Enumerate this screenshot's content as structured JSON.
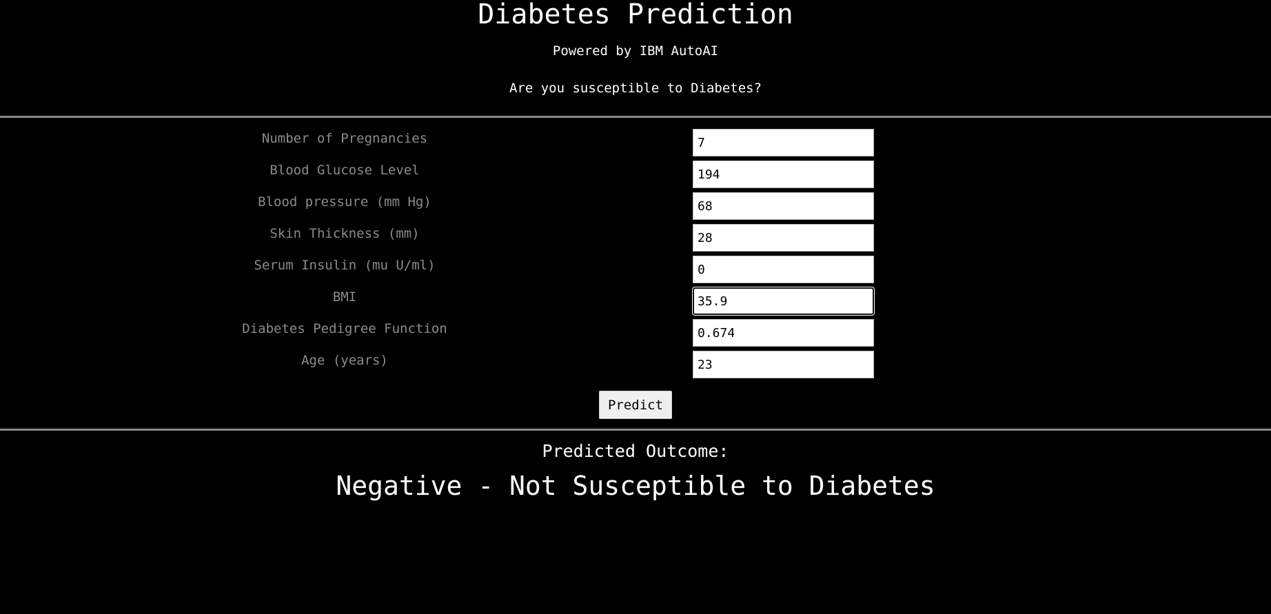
{
  "header": {
    "title": "Diabetes Prediction",
    "subtitle": "Powered by IBM AutoAI",
    "question": "Are you susceptible to Diabetes?"
  },
  "form": {
    "fields": [
      {
        "label": "Number of Pregnancies",
        "value": "7"
      },
      {
        "label": "Blood Glucose Level",
        "value": "194"
      },
      {
        "label": "Blood pressure (mm Hg)",
        "value": "68"
      },
      {
        "label": "Skin Thickness (mm)",
        "value": "28"
      },
      {
        "label": "Serum Insulin (mu U/ml)",
        "value": "0"
      },
      {
        "label": "BMI",
        "value": "35.9",
        "focused": true
      },
      {
        "label": "Diabetes Pedigree Function",
        "value": "0.674"
      },
      {
        "label": "Age (years)",
        "value": "23"
      }
    ],
    "submit_label": "Predict"
  },
  "result": {
    "label": "Predicted Outcome:",
    "value": "Negative - Not Susceptible to Diabetes"
  }
}
